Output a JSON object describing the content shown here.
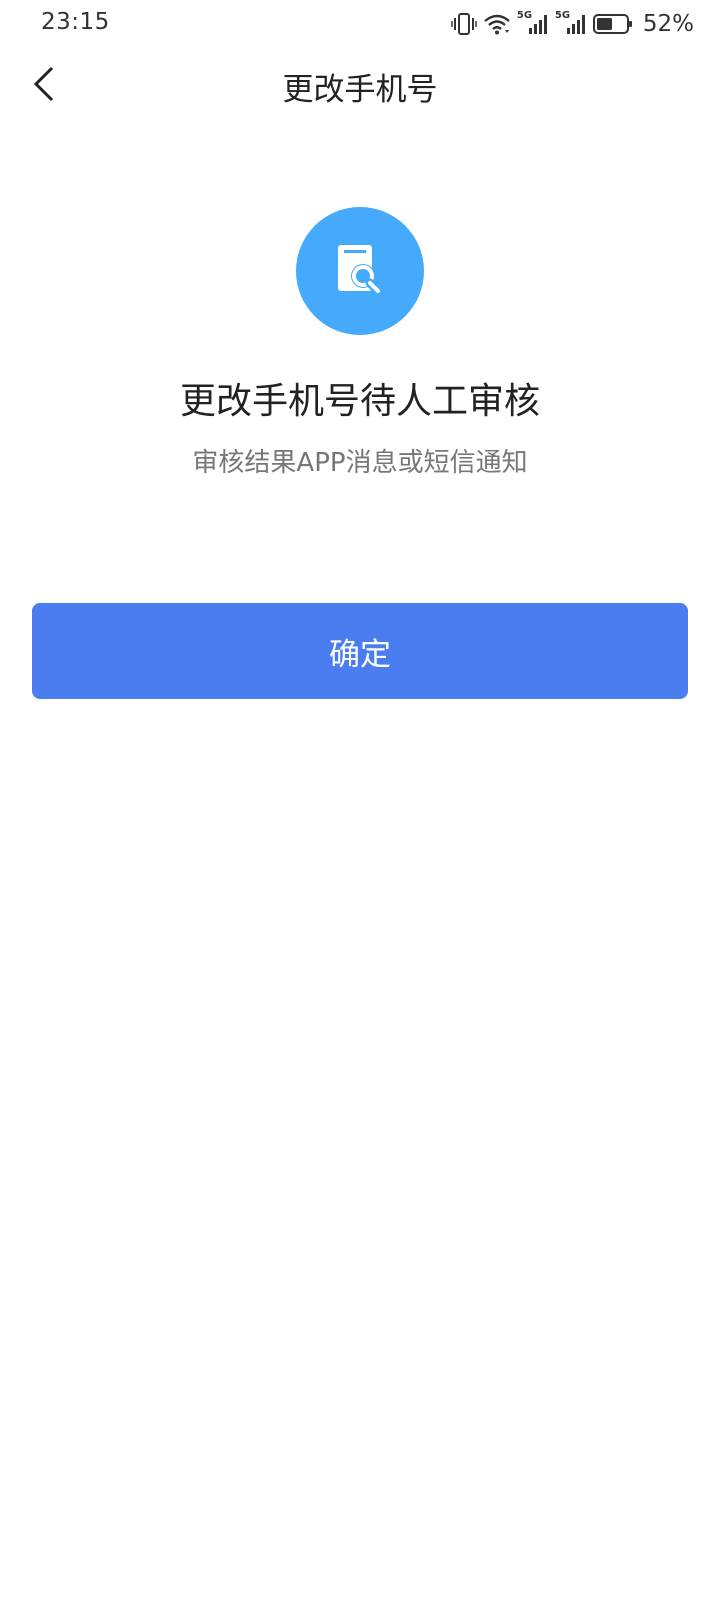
{
  "status_bar": {
    "time": "23:15",
    "battery_percent": "52%",
    "battery_level": 0.52,
    "network_1": "5G",
    "network_2": "5G",
    "icons": [
      "vibrate-icon",
      "wifi-icon",
      "signal-5g-icon",
      "signal-5g-icon",
      "battery-icon"
    ]
  },
  "header": {
    "title": "更改手机号",
    "back_icon": "chevron-left-icon"
  },
  "result": {
    "icon": "document-search-icon",
    "title": "更改手机号待人工审核",
    "subtitle": "审核结果APP消息或短信通知"
  },
  "actions": {
    "confirm_label": "确定"
  },
  "colors": {
    "primary_button": "#4a7ef0",
    "icon_circle": "#45a9fc",
    "subtitle_text": "#777777"
  }
}
